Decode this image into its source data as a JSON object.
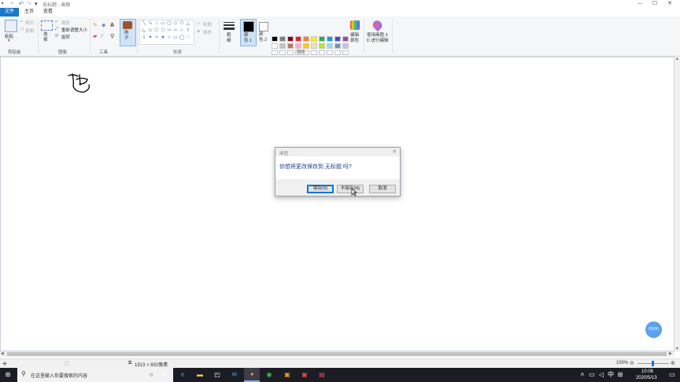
{
  "window": {
    "title": "无标题 - 画图",
    "controls": [
      "minimize",
      "maximize",
      "close"
    ]
  },
  "quick_access": [
    "save-icon",
    "undo-icon",
    "redo-icon",
    "customize-icon"
  ],
  "tabs": [
    {
      "label": "文件",
      "active": false
    },
    {
      "label": "主页",
      "active": true
    },
    {
      "label": "查看",
      "active": false
    }
  ],
  "ribbon": {
    "clipboard": {
      "paste": "粘贴",
      "cut": "剪切",
      "copy": "复制",
      "group": "剪贴板"
    },
    "image": {
      "select": "选\n择",
      "crop": "裁剪",
      "resize": "重新调整大小",
      "rotate": "旋转",
      "group": "图像"
    },
    "tools": {
      "brushes": "刷\n子",
      "group": "工具"
    },
    "shapes": {
      "outline": "轮廓",
      "fill": "填充",
      "group": "形状"
    },
    "size": "粗\n细",
    "colors": {
      "color1": "颜\n色 1",
      "color2": "颜\n色 2",
      "edit": "编辑\n颜色",
      "paint3d": "使用画图 3\nD 进行编辑",
      "group": "颜色",
      "palette_row1": [
        "#000000",
        "#7f7f7f",
        "#880015",
        "#ed1c24",
        "#ff7f27",
        "#fff200",
        "#22b14c",
        "#00a2e8",
        "#3f48cc",
        "#a349a4"
      ],
      "palette_row2": [
        "#ffffff",
        "#c3c3c3",
        "#b97a57",
        "#ffaec9",
        "#ffc90e",
        "#efe4b0",
        "#b5e61d",
        "#99d9ea",
        "#7092be",
        "#c8bfe7"
      ],
      "color1_value": "#000000",
      "color2_value": "#ffffff"
    }
  },
  "canvas": {
    "drawing": "handwritten scribble"
  },
  "dialog": {
    "title": "画图",
    "message": "你想将更改保存到 无标题 吗?",
    "buttons": {
      "save": "保存(S)",
      "dont_save": "不保存(N)",
      "cancel": "取消"
    }
  },
  "statusbar": {
    "dimensions": "1913 × 892像素",
    "zoom": "100%"
  },
  "floating_button": "00:00",
  "taskbar": {
    "search_placeholder": "在这里输入你要搜索的内容",
    "time": "10:06",
    "date": "2020/5/13"
  }
}
